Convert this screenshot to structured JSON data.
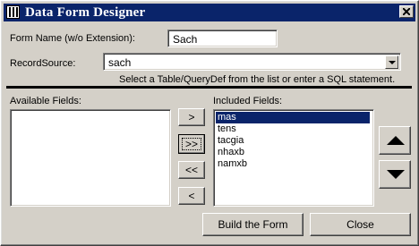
{
  "window": {
    "title": "Data Form Designer"
  },
  "form": {
    "form_name_label": "Form Name (w/o Extension):",
    "form_name_value": "Sach",
    "record_source_label": "RecordSource:",
    "record_source_value": "sach",
    "hint": "Select a Table/QueryDef from the list or enter a SQL statement."
  },
  "available": {
    "label": "Available Fields:",
    "items": []
  },
  "included": {
    "label": "Included Fields:",
    "items": [
      "mas",
      "tens",
      "tacgia",
      "nhaxb",
      "namxb"
    ],
    "selected_index": 0
  },
  "move_buttons": {
    "add_one": ">",
    "add_all": ">>",
    "remove_all": "<<",
    "remove_one": "<"
  },
  "footer": {
    "build_label": "Build the Form",
    "close_label": "Close"
  }
}
